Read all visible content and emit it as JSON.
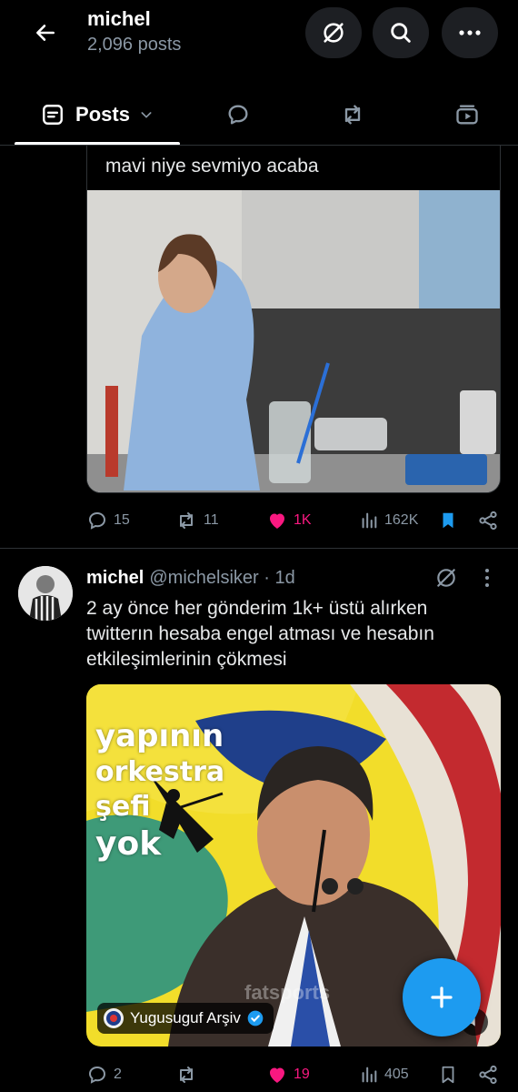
{
  "header": {
    "title": "michel",
    "post_count": "2,096 posts"
  },
  "tabs": [
    {
      "label": "Posts"
    }
  ],
  "post1": {
    "text": "mavi niye sevmiyo acaba",
    "replies": "15",
    "reposts": "11",
    "likes": "1K",
    "views": "162K"
  },
  "post2": {
    "name": "michel",
    "handle": "@michelsiker",
    "time": "· 1d",
    "text": "2 ay önce her gönderim 1k+ üstü alırken twitterın hesaba engel atması ve hesabın etkileşimlerinin çökmesi",
    "image_overlay": [
      "yapının",
      "orkestra",
      "şefi",
      "yok"
    ],
    "image_watermark": "fatsports",
    "tagged_user": "Yugusuguf Arşiv",
    "replies": "2",
    "reposts": "",
    "likes": "19",
    "views": "405"
  },
  "colors": {
    "background": "#000000",
    "accent": "#1d9bf0",
    "like": "#f91880",
    "muted": "#8b98a5"
  }
}
